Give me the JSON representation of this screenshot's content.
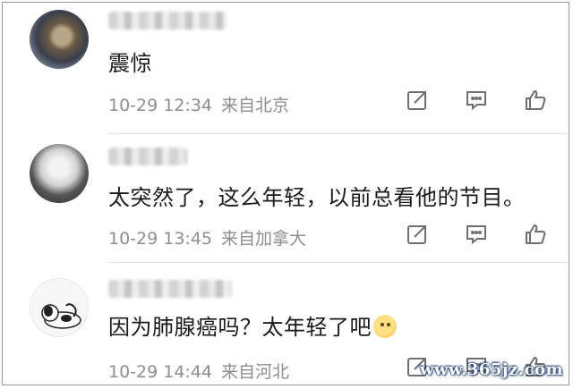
{
  "comments": [
    {
      "text": "震惊",
      "time": "10-29 12:34",
      "location": "来自北京"
    },
    {
      "text": "太突然了，这么年轻，以前总看他的节目。",
      "time": "10-29 13:45",
      "location": "来自加拿大"
    },
    {
      "text": "因为肺腺癌吗？太年轻了吧",
      "emoji": "hugging-face-emoji",
      "time": "10-29 14:44",
      "location": "来自河北"
    }
  ],
  "icons": {
    "share": "share-icon",
    "reply": "comment-icon",
    "like": "thumbs-up-icon"
  },
  "colors": {
    "text": "#1a1a1a",
    "meta": "#8e8e8e",
    "icon": "#6f6f6f",
    "divider": "#e3e3e3"
  },
  "watermark": "www.365jz.com"
}
